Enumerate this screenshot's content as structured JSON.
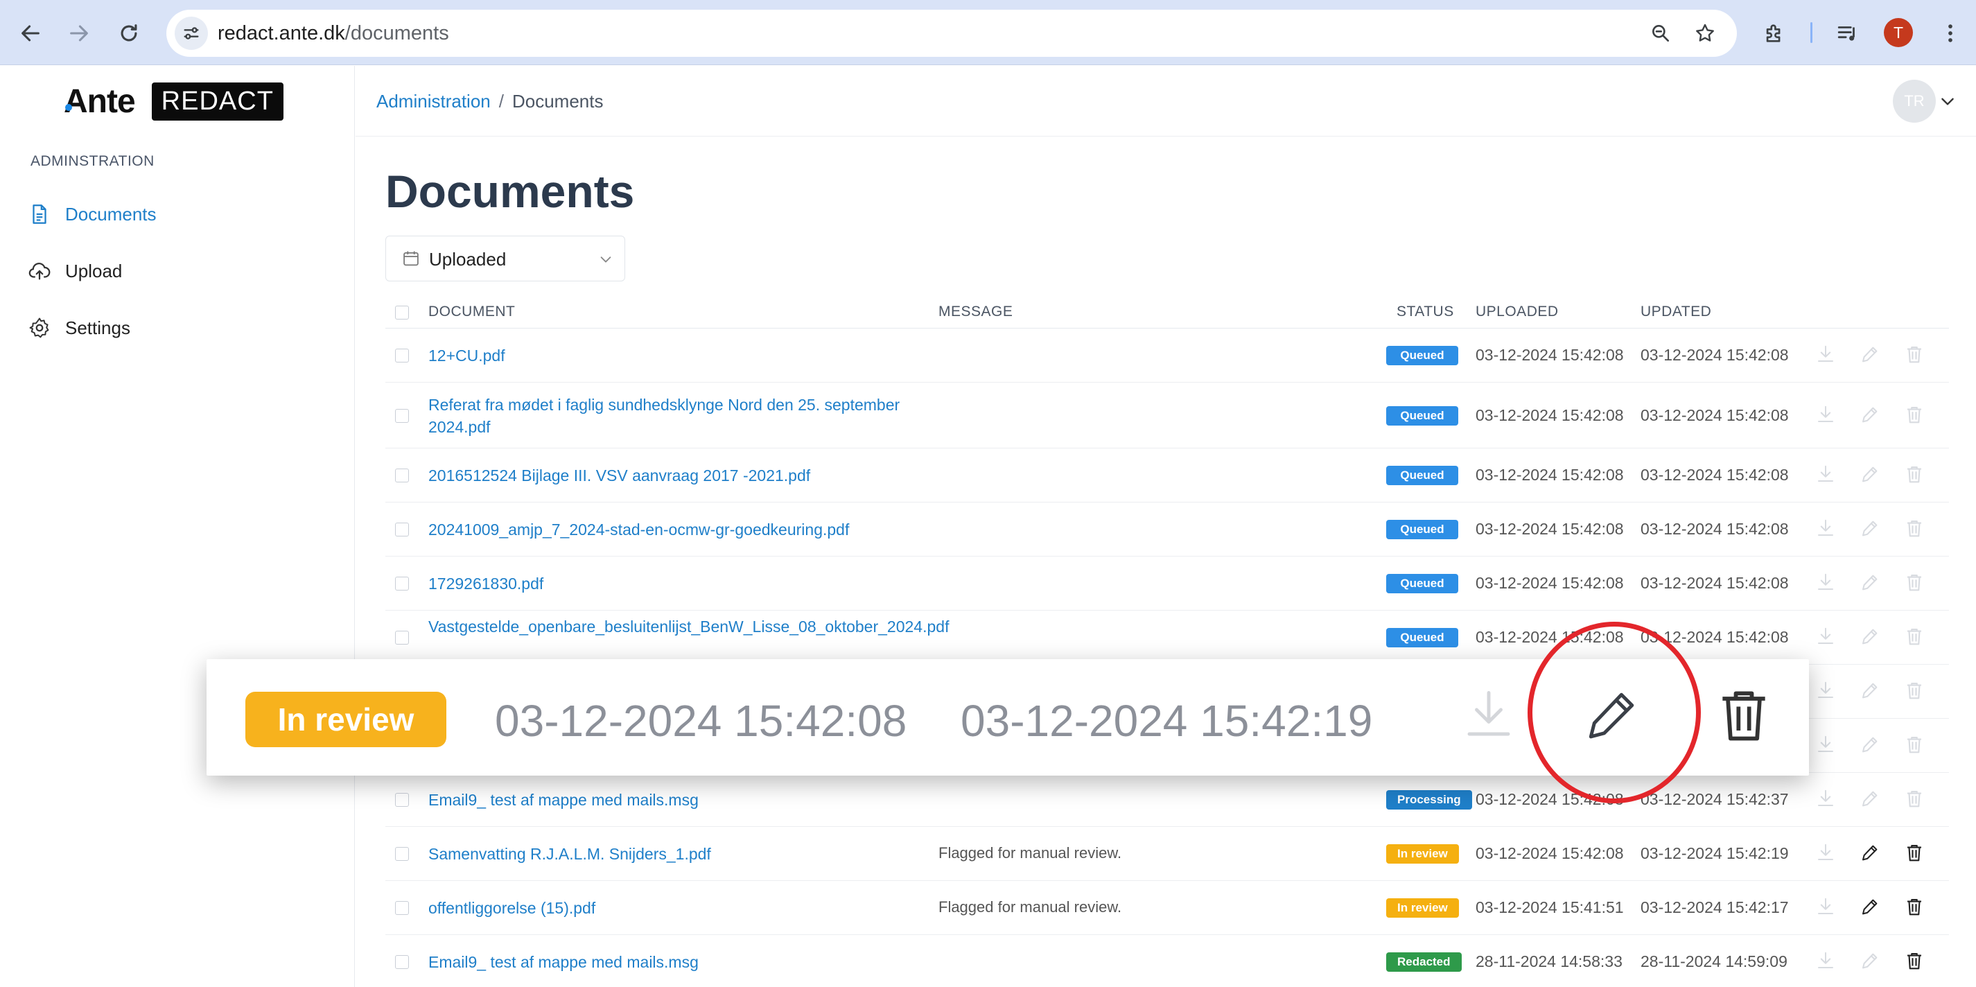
{
  "browser": {
    "url_host": "redact.ante.dk",
    "url_path": "/documents",
    "profile_initial": "T"
  },
  "sidebar": {
    "logo_text": "Ante",
    "logo_badge": "REDACT",
    "section_title": "ADMINSTRATION",
    "items": [
      {
        "label": "Documents",
        "icon": "document-icon",
        "active": true
      },
      {
        "label": "Upload",
        "icon": "cloud-upload-icon",
        "active": false
      },
      {
        "label": "Settings",
        "icon": "gear-icon",
        "active": false
      }
    ]
  },
  "header": {
    "breadcrumb_root": "Administration",
    "breadcrumb_sep": "/",
    "breadcrumb_current": "Documents",
    "avatar_initials": "TR"
  },
  "main": {
    "title": "Documents",
    "filter": {
      "selected": "Uploaded"
    },
    "columns": {
      "document": "DOCUMENT",
      "message": "MESSAGE",
      "status": "STATUS",
      "uploaded": "UPLOADED",
      "updated": "UPDATED"
    },
    "rows": [
      {
        "document": "12+CU.pdf",
        "message": "",
        "status": "Queued",
        "status_kind": "queued",
        "uploaded": "03-12-2024 15:42:08",
        "updated": "03-12-2024 15:42:08",
        "edit_enabled": false,
        "delete_enabled": false
      },
      {
        "document": "Referat fra mødet i faglig sundhedsklynge Nord den 25. september 2024.pdf",
        "message": "",
        "status": "Queued",
        "status_kind": "queued",
        "uploaded": "03-12-2024 15:42:08",
        "updated": "03-12-2024 15:42:08",
        "edit_enabled": false,
        "delete_enabled": false
      },
      {
        "document": "2016512524 Bijlage III. VSV aanvraag 2017 -2021.pdf",
        "message": "",
        "status": "Queued",
        "status_kind": "queued",
        "uploaded": "03-12-2024 15:42:08",
        "updated": "03-12-2024 15:42:08",
        "edit_enabled": false,
        "delete_enabled": false
      },
      {
        "document": "20241009_amjp_7_2024-stad-en-ocmw-gr-goedkeuring.pdf",
        "message": "",
        "status": "Queued",
        "status_kind": "queued",
        "uploaded": "03-12-2024 15:42:08",
        "updated": "03-12-2024 15:42:08",
        "edit_enabled": false,
        "delete_enabled": false
      },
      {
        "document": "1729261830.pdf",
        "message": "",
        "status": "Queued",
        "status_kind": "queued",
        "uploaded": "03-12-2024 15:42:08",
        "updated": "03-12-2024 15:42:08",
        "edit_enabled": false,
        "delete_enabled": false
      },
      {
        "document": "Vastgestelde_openbare_besluitenlijst_BenW_Lisse_08_oktober_2024.pdf",
        "message": "",
        "status": "Queued",
        "status_kind": "queued",
        "uploaded": "03-12-2024 15:42:08",
        "updated": "03-12-2024 15:42:08",
        "edit_enabled": false,
        "delete_enabled": false
      },
      {
        "document": "",
        "message": "",
        "status": "",
        "status_kind": "",
        "uploaded": "",
        "updated": "",
        "edit_enabled": false,
        "delete_enabled": false
      },
      {
        "document": "",
        "message": "",
        "status": "",
        "status_kind": "",
        "uploaded": "",
        "updated": "",
        "edit_enabled": false,
        "delete_enabled": false
      },
      {
        "document": "Email9_ test af mappe med mails.msg",
        "message": "",
        "status": "Processing",
        "status_kind": "processing",
        "uploaded": "03-12-2024 15:42:08",
        "updated": "03-12-2024 15:42:37",
        "edit_enabled": false,
        "delete_enabled": false
      },
      {
        "document": "Samenvatting R.J.A.L.M. Snijders_1.pdf",
        "message": "Flagged for manual review.",
        "status": "In review",
        "status_kind": "review",
        "uploaded": "03-12-2024 15:42:08",
        "updated": "03-12-2024 15:42:19",
        "edit_enabled": true,
        "delete_enabled": true
      },
      {
        "document": "offentliggorelse (15).pdf",
        "message": "Flagged for manual review.",
        "status": "In review",
        "status_kind": "review",
        "uploaded": "03-12-2024 15:41:51",
        "updated": "03-12-2024 15:42:17",
        "edit_enabled": true,
        "delete_enabled": true
      },
      {
        "document": "Email9_ test af mappe med mails.msg",
        "message": "",
        "status": "Redacted",
        "status_kind": "redacted",
        "uploaded": "28-11-2024 14:58:33",
        "updated": "28-11-2024 14:59:09",
        "edit_enabled": false,
        "delete_enabled": true
      }
    ]
  },
  "zoom": {
    "status": "In review",
    "uploaded": "03-12-2024 15:42:08",
    "updated": "03-12-2024 15:42:19"
  },
  "colors": {
    "link": "#1f7fc9",
    "queued": "#2d8fe6",
    "review": "#f5b010",
    "processing": "#1f7fc9",
    "redacted": "#2e9a4a",
    "highlight_circle": "#e3262b"
  }
}
